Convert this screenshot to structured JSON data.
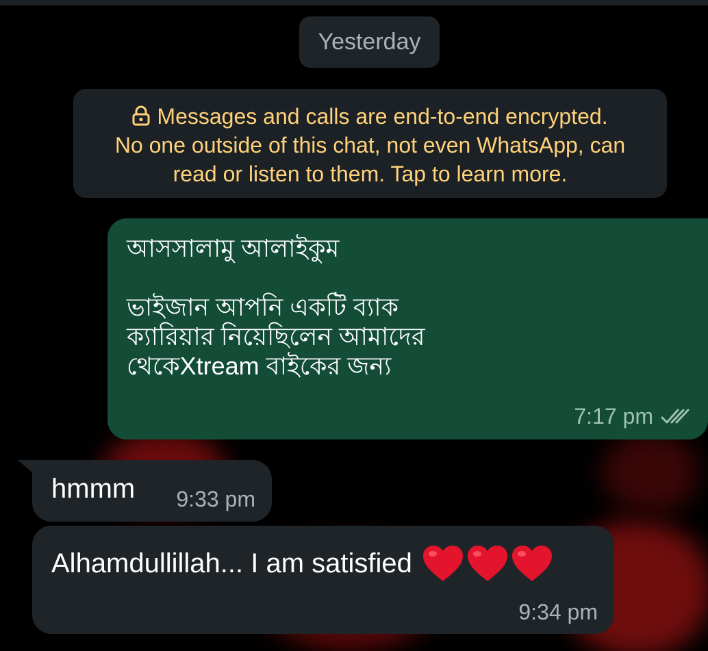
{
  "date_separator": "Yesterday",
  "encryption_notice": {
    "lines": [
      "Messages and calls are end-to-end encrypted.",
      "No one outside of this chat, not even WhatsApp, can",
      "read or listen to them. Tap to learn more."
    ],
    "icon": "lock-icon"
  },
  "messages": [
    {
      "direction": "outgoing",
      "text": "আসসালামু আলাইকুম\n\nভাইজান আপনি একটি ব্যাক\nক্যারিয়ার নিয়েছিলেন আমাদের\nথেকেXtream বাইকের জন্য",
      "time": "7:17 pm",
      "status_icon": "double-check-icon"
    },
    {
      "direction": "incoming",
      "text": "hmmm",
      "time": "9:33 pm"
    },
    {
      "direction": "incoming",
      "text": "Alhamdullillah... I am satisfied",
      "emoji": [
        "heart-icon",
        "heart-icon",
        "heart-icon"
      ],
      "time": "9:34 pm"
    }
  ],
  "colors": {
    "background": "#000000",
    "outgoing_bubble": "#144d37",
    "incoming_bubble": "#1f2429",
    "notice_text": "#ffd279",
    "heart": "#e3142b"
  }
}
